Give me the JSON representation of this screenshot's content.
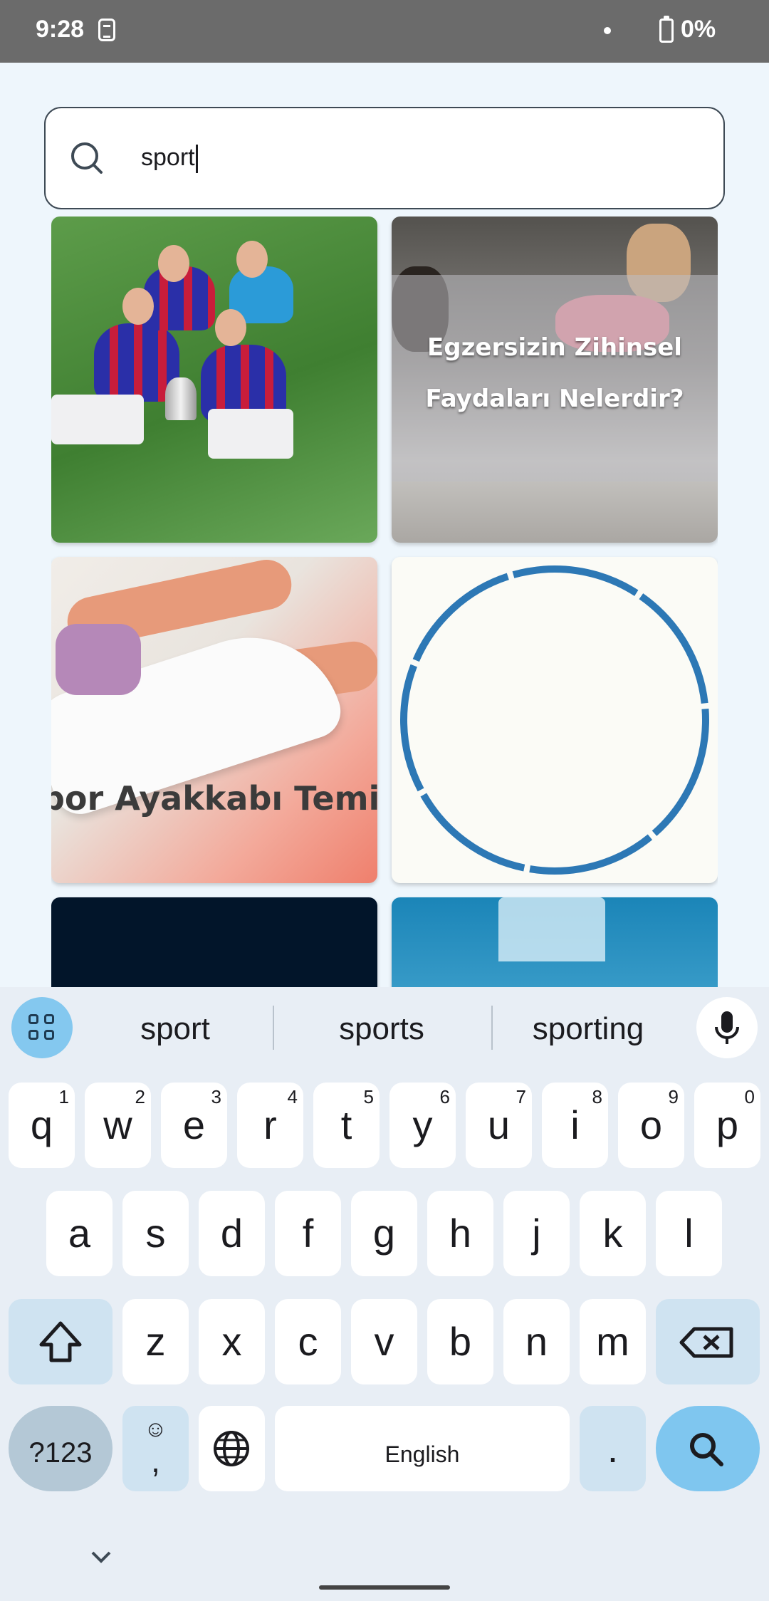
{
  "status_bar": {
    "time": "9:28",
    "battery": "0%"
  },
  "search": {
    "query": "sport",
    "icon": "search-icon"
  },
  "results": {
    "cards": [
      {
        "name": "result-card-football-team",
        "overlay_lines": []
      },
      {
        "name": "result-card-exercise",
        "overlay_lines": [
          "Egzersizin Zihinsel",
          "Faydaları Nelerdir?"
        ]
      },
      {
        "name": "result-card-shoe-cleaning",
        "caption": "por Ayakkabı Temiz"
      },
      {
        "name": "result-card-hoop"
      },
      {
        "name": "result-card-dark"
      },
      {
        "name": "result-card-blue-tower"
      }
    ]
  },
  "keyboard": {
    "suggestions": [
      "sport",
      "sports",
      "sporting"
    ],
    "row1": [
      {
        "k": "q",
        "n": "1"
      },
      {
        "k": "w",
        "n": "2"
      },
      {
        "k": "e",
        "n": "3"
      },
      {
        "k": "r",
        "n": "4"
      },
      {
        "k": "t",
        "n": "5"
      },
      {
        "k": "y",
        "n": "6"
      },
      {
        "k": "u",
        "n": "7"
      },
      {
        "k": "i",
        "n": "8"
      },
      {
        "k": "o",
        "n": "9"
      },
      {
        "k": "p",
        "n": "0"
      }
    ],
    "row2": [
      "a",
      "s",
      "d",
      "f",
      "g",
      "h",
      "j",
      "k",
      "l"
    ],
    "row3": [
      "z",
      "x",
      "c",
      "v",
      "b",
      "n",
      "m"
    ],
    "symbols_label": "?123",
    "emoji_label": "☺",
    "comma_label": ",",
    "space_label": "English",
    "period_label": ".",
    "accent_color": "#7fc6ef"
  }
}
